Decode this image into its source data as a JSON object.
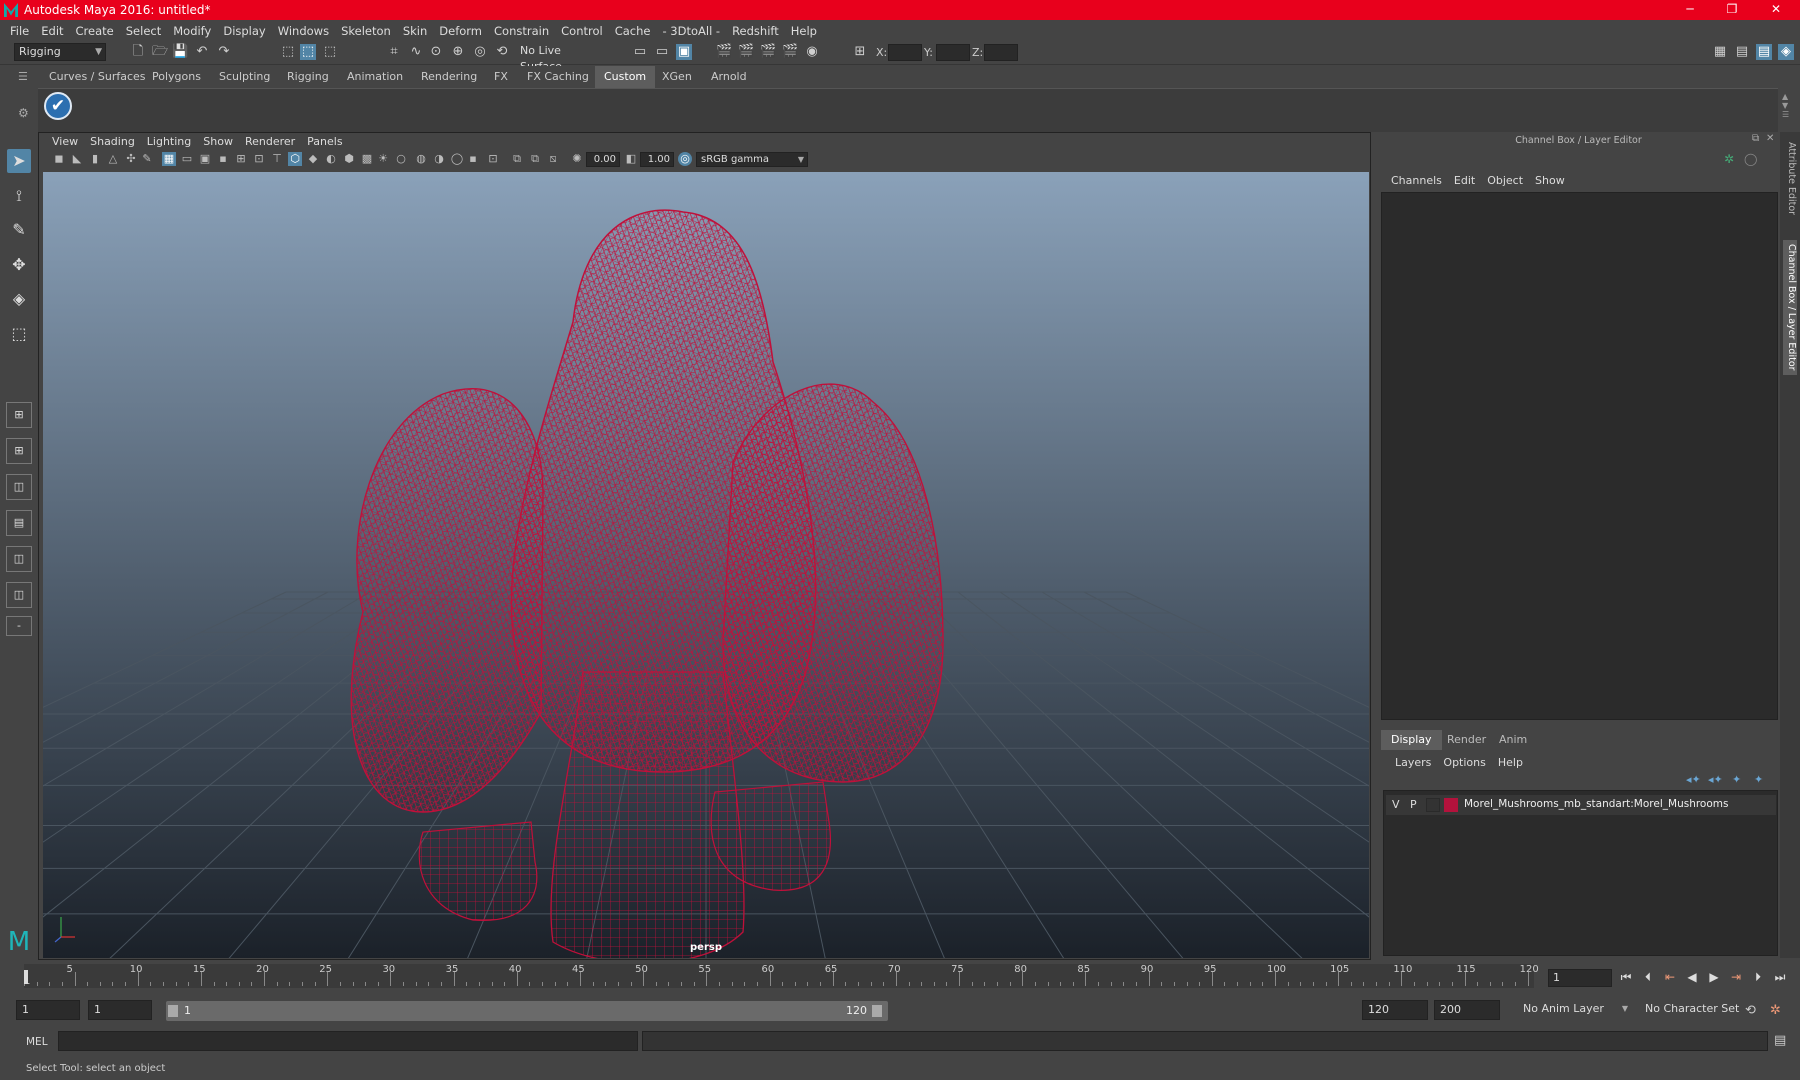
{
  "window": {
    "title": "Autodesk Maya 2016: untitled*",
    "minimize": "─",
    "maximize": "❐",
    "close": "✕"
  },
  "menubar": {
    "items": [
      "File",
      "Edit",
      "Create",
      "Select",
      "Modify",
      "Display",
      "Windows",
      "Skeleton",
      "Skin",
      "Deform",
      "Constrain",
      "Control",
      "Cache",
      "- 3DtoAll -",
      "Redshift",
      "Help"
    ]
  },
  "statusline": {
    "menuset": "Rigging",
    "live_surface": "No Live Surface",
    "x_label": "X:",
    "y_label": "Y:",
    "z_label": "Z:"
  },
  "shelf": {
    "tabs": [
      "Curves / Surfaces",
      "Polygons",
      "Sculpting",
      "Rigging",
      "Animation",
      "Rendering",
      "FX",
      "FX Caching",
      "Custom",
      "XGen",
      "Arnold"
    ],
    "active": "Custom",
    "icon": "✔"
  },
  "viewport": {
    "menu": [
      "View",
      "Shading",
      "Lighting",
      "Show",
      "Renderer",
      "Panels"
    ],
    "exposure": "0.00",
    "gamma": "1.00",
    "colorspace": "sRGB gamma",
    "camera": "persp",
    "wire_color": "#c0103a",
    "bg_top": "#8aa1b9",
    "bg_bottom": "#1b2129"
  },
  "right_panel": {
    "title": "Channel Box / Layer Editor",
    "channel_menu": [
      "Channels",
      "Edit",
      "Object",
      "Show"
    ],
    "layer_tabs": [
      "Display",
      "Render",
      "Anim"
    ],
    "layer_menu": [
      "Layers",
      "Options",
      "Help"
    ],
    "layer": {
      "v": "V",
      "p": "P",
      "name": "Morel_Mushrooms_mb_standart:Morel_Mushrooms",
      "color": "#b3123c"
    },
    "side_tabs": [
      "Attribute Editor",
      "Channel Box / Layer Editor"
    ]
  },
  "timeline": {
    "ticks": [
      "5",
      "10",
      "15",
      "20",
      "25",
      "30",
      "35",
      "40",
      "45",
      "50",
      "55",
      "60",
      "65",
      "70",
      "75",
      "80",
      "85",
      "90",
      "95",
      "100",
      "105",
      "110",
      "115",
      "120"
    ],
    "start_marker": "1",
    "current_frame": "1"
  },
  "range": {
    "start": "1",
    "start2": "1",
    "range_start": "1",
    "range_end": "120",
    "end": "120",
    "end2": "200",
    "anim_layer": "No Anim Layer",
    "char_set": "No Character Set"
  },
  "command": {
    "label": "MEL"
  },
  "help_line": "Select Tool: select an object"
}
